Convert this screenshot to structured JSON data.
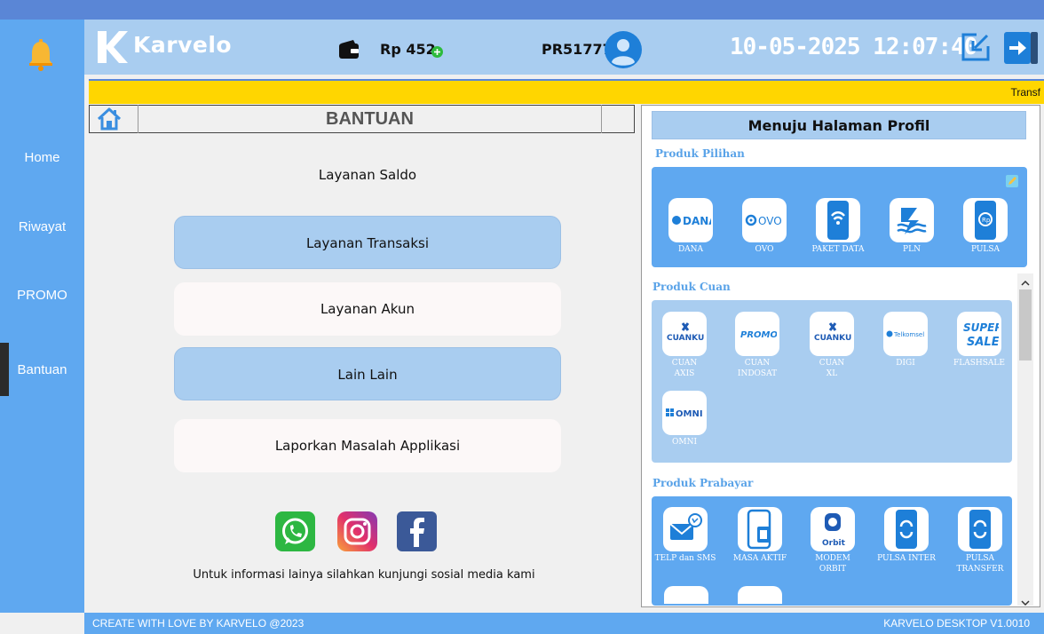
{
  "app": {
    "logo_text": "Karvelo"
  },
  "header": {
    "balance": "Rp 452",
    "user_id": "PR51777",
    "datetime": "10-05-2025 12:07:40"
  },
  "sidebar": {
    "items": [
      {
        "label": "Home"
      },
      {
        "label": "Riwayat"
      },
      {
        "label": "PROMO"
      },
      {
        "label": "Bantuan"
      }
    ]
  },
  "ticker": {
    "text": "Transf"
  },
  "page": {
    "title": "BANTUAN"
  },
  "menu": {
    "saldo": "Layanan Saldo",
    "transaksi": "Layanan Transaksi",
    "akun": "Layanan Akun",
    "lain": "Lain Lain",
    "laporkan": "Laporkan Masalah Applikasi"
  },
  "social": {
    "caption": "Untuk informasi lainya silahkan kunjungi sosial media kami"
  },
  "right": {
    "profile_button": "Menuju Halaman Profil",
    "sections": {
      "pilihan": "Produk Pilihan",
      "cuan": "Produk Cuan",
      "prabayar": "Produk Prabayar"
    },
    "pilihan_items": [
      {
        "label": "DANA",
        "icon": "dana-logo"
      },
      {
        "label": "OVO",
        "icon": "ovo-logo"
      },
      {
        "label": "PAKET DATA",
        "icon": "wifi-phone-icon"
      },
      {
        "label": "PLN",
        "icon": "pln-logo"
      },
      {
        "label": "PULSA",
        "icon": "pulsa-phone-icon"
      }
    ],
    "cuan_items": [
      {
        "label": "CUAN\nAXIS",
        "icon_text": "CUANKU"
      },
      {
        "label": "CUAN\nINDOSAT",
        "icon_text": "PROMO"
      },
      {
        "label": "CUAN\nXL",
        "icon_text": "CUANKU"
      },
      {
        "label": "DIGI",
        "icon_text": "Telkomsel"
      },
      {
        "label": "FLASHSALE",
        "icon_text": "SUPER SALE"
      },
      {
        "label": "OMNI",
        "icon_text": "OMNI"
      }
    ],
    "prabayar_items": [
      {
        "label": "TELP dan SMS"
      },
      {
        "label": "MASA AKTIF"
      },
      {
        "label": "MODEM\nORBIT",
        "icon_text": "Orbit"
      },
      {
        "label": "PULSA INTER"
      },
      {
        "label": "PULSA\nTRANSFER"
      }
    ]
  },
  "footer": {
    "left": "CREATE WITH LOVE BY KARVELO @2023",
    "right": "KARVELO DESKTOP V1.0010"
  },
  "colors": {
    "sidebar": "#5fa8f0",
    "header": "#a9cdf0",
    "ticker": "#ffd600",
    "card": "#5fa8f0",
    "card_light": "#a9cdf0"
  }
}
